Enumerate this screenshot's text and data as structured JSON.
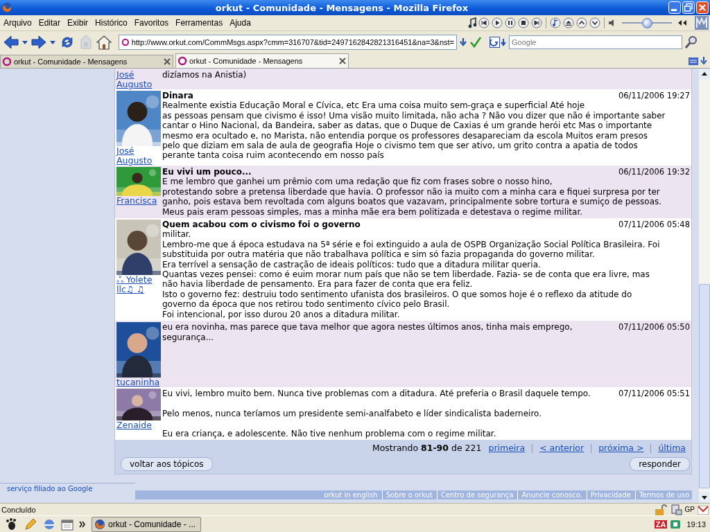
{
  "window": {
    "title": "orkut - Comunidade - Mensagens - Mozilla Firefox"
  },
  "menu": [
    "Arquivo",
    "Editar",
    "Exibir",
    "Histórico",
    "Favoritos",
    "Ferramentas",
    "Ajuda"
  ],
  "media_player": {
    "volume": {
      "level": 0.5
    }
  },
  "address": {
    "value": "http://www.orkut.com/CommMsgs.aspx?cmm=316707&tid=2497162842821316451&na=3&nst="
  },
  "search": {
    "placeholder": "Google"
  },
  "tabs": [
    {
      "label": "orkut - Comunidade - Mensagens",
      "selected": false
    },
    {
      "label": "orkut - Comunidade - Mensagens",
      "selected": true
    }
  ],
  "posts": [
    {
      "author": "José\nAugusto",
      "shaded": true,
      "text": "dizíamos na Anistia)"
    },
    {
      "author": "José\nAugusto",
      "shaded": false,
      "title": "Dinara",
      "date": "06/11/2006 19:27",
      "text": "Realmente existia Educação Moral e Cívica, etc Era uma coisa muito sem-graça e superficial Até hoje\nas pessoas pensam que civismo é isso! Uma visão muito limitada, não acha ? Não vou dizer que não é importante saber\ncantar o Hino Nacional, da Bandeira, saber as datas, que o Duque de Caxias é um grande herói etc Mas o importante\nmesmo era ocultado e, no Marista, não entendia porque os professores desapareciam da escola Muitos eram presos\npelo que diziam em sala de aula de geografia Hoje o civismo tem que ser ativo, um grito contra a apatia de todos\nperante tanta coisa ruim acontecendo em nosso país"
    },
    {
      "author": "Francisca",
      "shaded": true,
      "title": "Eu vivi um pouco...",
      "date": "06/11/2006 19:32",
      "text": "E me lembro que ganhei um prêmio com uma redação que fiz com frases sobre o nosso hino,\nprotestando sobre a pretensa liberdade que havia. O professor não ia muito com a minha cara e fiquei surpresa por ter\nganho, pois estava bem revoltada com alguns boatos que vazavam, principalmente sobre tortura e sumiço de pessoas.\nMeus pais eram pessoas simples, mas a minha mãe era bem politizada e detestava o regime militar."
    },
    {
      "author": "ஃ Yolete\nllc♫ ♫",
      "shaded": false,
      "title": "Quem acabou com o civismo foi o governo",
      "date": "07/11/2006 05:48",
      "text": "militar.\nLembro-me que á época estudava na 5ª série e foi extinguido a aula de OSPB Organização Social Política Brasileira. Foi\nsubstituida por outra matéria que não trabalhava política e sim só fazia propaganda do governo militar.\nEra terrível a sensação de castração de ideais políticos: tudo que a ditadura militar queria.\nQuantas vezes pensei: como é euim morar num país que não se tem liberdade. Fazia- se de conta que era livre, mas\nnão havia liberdade de pensamento. Era para fazer de conta que era feliz.\nIsto o governo fez: destruiu todo sentimento ufanista dos brasileiros. O que somos hoje é o reflexo da atitude do\ngoverno da época que nos retirou todo sentimento cívico pelo Brasil.\nFoi intencional, por isso durou 20 anos a ditadura militar."
    },
    {
      "author": "tucaninha",
      "shaded": true,
      "date": "07/11/2006 05:50",
      "text": "eu era novinha, mas parece que tava melhor que agora nestes últimos anos, tinha mais emprego,\nsegurança..."
    },
    {
      "author": "Zenaide",
      "shaded": false,
      "date": "07/11/2006 05:51",
      "text": "Eu vivi, lembro muito bem. Nunca tive problemas com a ditadura. Até preferia o Brasil daquele tempo.\n\nPelo menos, nunca teríamos um presidente semi-analfabeto e líder sindicalista baderneiro.\n\nEu era criança, e adolescente. Não tive nenhum problema com o regime militar."
    }
  ],
  "pagination": {
    "summary": "Mostrando **81-90** de 221",
    "links": [
      "primeira",
      "< anterior",
      "próxima >",
      "última"
    ]
  },
  "buttons": {
    "back": "voltar aos tópicos",
    "reply": "responder"
  },
  "footer": {
    "affiliate": "serviço filiado ao Google",
    "links": [
      "orkut in english",
      "Sobre o orkut",
      "Centro de segurança",
      "Anuncie conosco.",
      "Privacidade",
      "Termos de uso"
    ]
  },
  "status_bar": {
    "text": "Concluído",
    "indicator": "GP"
  },
  "taskbar": {
    "task": "orkut - Comunidade - ...",
    "tray_label": "ZA",
    "clock": "19:13"
  }
}
